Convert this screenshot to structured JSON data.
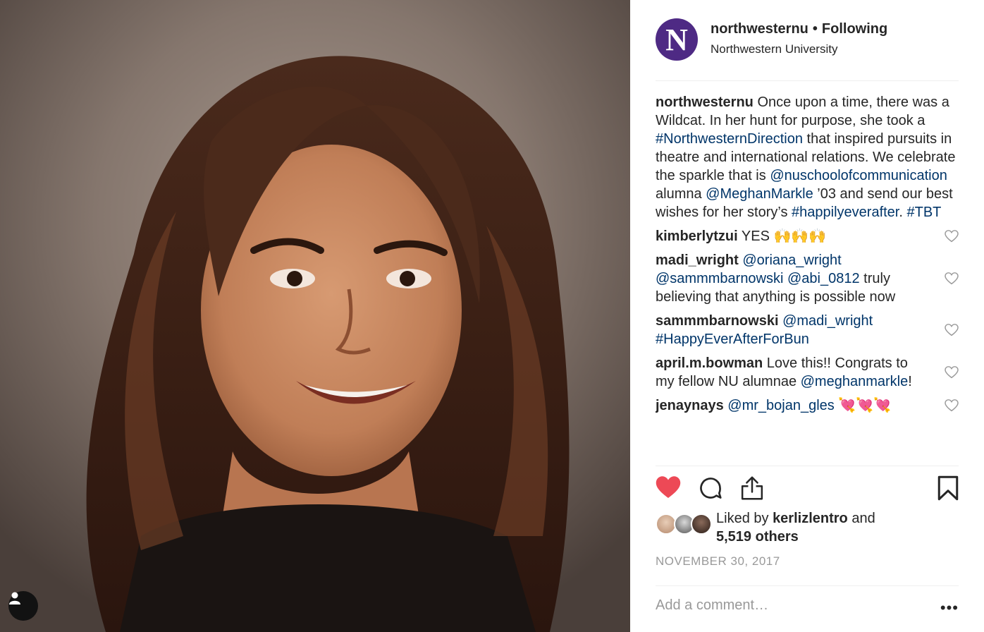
{
  "post": {
    "username": "northwesternu",
    "follow_status": "Following",
    "location": "Northwestern University",
    "avatar_letter": "N"
  },
  "caption": {
    "username": "northwesternu",
    "t1": " Once upon a time, there was a Wildcat. In her hunt for purpose, she took a ",
    "hashtag1": "#NorthwesternDirection",
    "t2": " that inspired pursuits in theatre and international relations. We celebrate the sparkle that is ",
    "mention1": "@nuschoolofcommunication",
    "t3": " alumna ",
    "mention2": "@MeghanMarkle",
    "t4": " ’03 and send our best wishes for her story’s ",
    "hashtag2": "#happilyeverafter",
    "t5": ". ",
    "hashtag3": "#TBT"
  },
  "comments": [
    {
      "username": "kimberlytzui",
      "text": " YES 🙌🙌🙌"
    },
    {
      "username": "madi_wright",
      "m1": " @oriana_wright @sammmbarnowski @abi_0812",
      "text": " truly believing that anything is possible now"
    },
    {
      "username": "sammmbarnowski",
      "m1": " @madi_wright #HappyEverAfterForBun"
    },
    {
      "username": "april.m.bowman",
      "text": " Love this!! Congrats to my fellow NU alumnae ",
      "m1": "@meghanmarkle",
      "text2": "!"
    },
    {
      "username": "jenaynays",
      "m1": " @mr_bojan_gles",
      "text": " 💘💘💘"
    }
  ],
  "likes": {
    "prefix": "Liked by ",
    "user": "kerlizlentro",
    "mid": " and",
    "count": "5,519 others"
  },
  "date": "NOVEMBER 30, 2017",
  "comment_placeholder": "Add a comment…",
  "more_label": "•••",
  "icons": [
    "heart-filled-icon",
    "comment-icon",
    "share-icon",
    "bookmark-icon",
    "user-tag-icon",
    "heart-outline-icon"
  ],
  "colors": {
    "liked": "#ed4956",
    "link": "#003569",
    "nu_purple": "#4e2a84"
  }
}
